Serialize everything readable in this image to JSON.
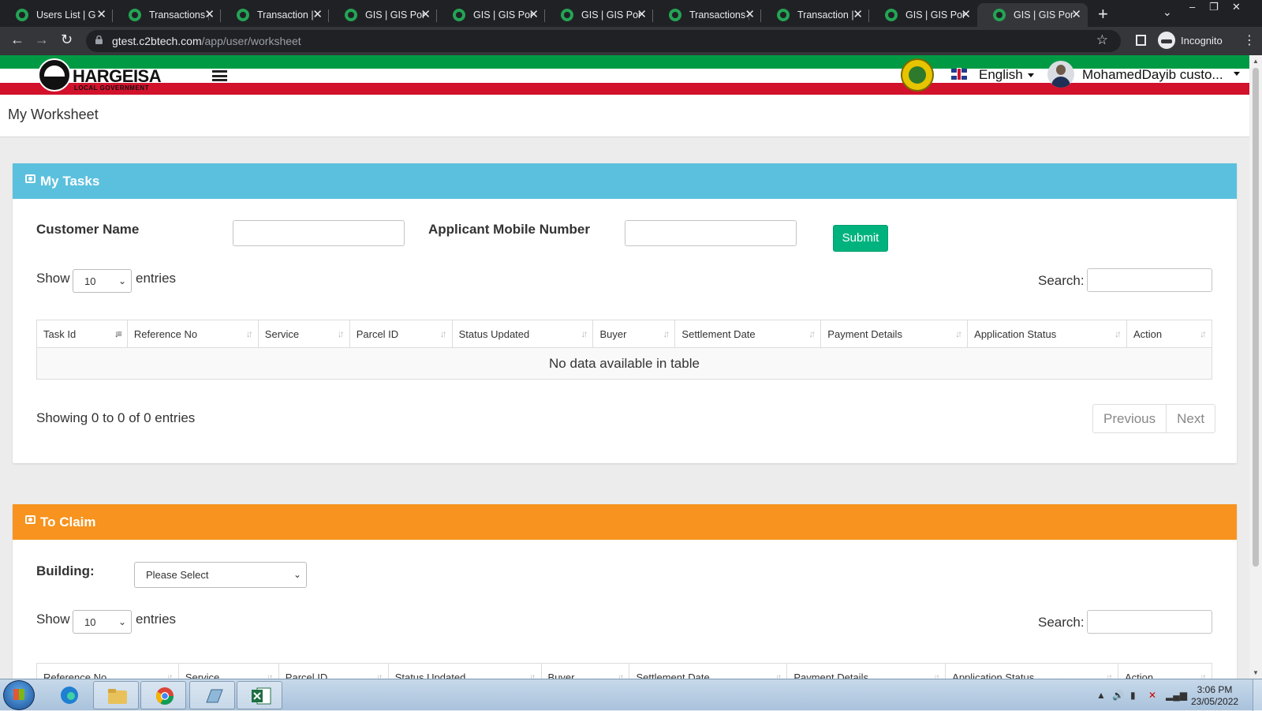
{
  "browser": {
    "tabs": [
      {
        "title": "Users List | GI",
        "active": false
      },
      {
        "title": "Transactions |",
        "active": false
      },
      {
        "title": "Transaction | C",
        "active": false
      },
      {
        "title": "GIS | GIS Port",
        "active": false
      },
      {
        "title": "GIS | GIS Port",
        "active": false
      },
      {
        "title": "GIS | GIS Port",
        "active": false
      },
      {
        "title": "Transactions |",
        "active": false
      },
      {
        "title": "Transaction | C",
        "active": false
      },
      {
        "title": "GIS | GIS Port",
        "active": false
      },
      {
        "title": "GIS | GIS Port",
        "active": true
      }
    ],
    "url_host": "gtest.c2btech.com",
    "url_path": "/app/user/worksheet",
    "incognito_label": "Incognito"
  },
  "header": {
    "logo_text": "HARGEISA",
    "logo_subtext": "LOCAL GOVERNMENT",
    "language": "English",
    "username": "MohamedDayib custo..."
  },
  "page": {
    "title": "My Worksheet"
  },
  "my_tasks": {
    "title": "My Tasks",
    "header_color": "#5bc0de",
    "customer_name_label": "Customer Name",
    "mobile_label": "Applicant Mobile Number",
    "submit_label": "Submit",
    "show_label": "Show",
    "entries_label": "entries",
    "page_length": "10",
    "search_label": "Search:",
    "columns": [
      "Task Id",
      "Reference No",
      "Service",
      "Parcel ID",
      "Status Updated",
      "Buyer",
      "Settlement Date",
      "Payment Details",
      "Application Status",
      "Action"
    ],
    "empty_text": "No data available in table",
    "info_text": "Showing 0 to 0 of 0 entries",
    "prev_label": "Previous",
    "next_label": "Next"
  },
  "to_claim": {
    "title": "To Claim",
    "header_color": "#f7931e",
    "building_label": "Building:",
    "building_value": "Please Select",
    "show_label": "Show",
    "entries_label": "entries",
    "page_length": "10",
    "search_label": "Search:",
    "columns": [
      "Reference No",
      "Service",
      "Parcel ID",
      "Status Updated",
      "Buyer",
      "Settlement Date",
      "Payment Details",
      "Application Status",
      "Action"
    ]
  },
  "taskbar": {
    "time": "3:06 PM",
    "date": "23/05/2022"
  },
  "colors": {
    "submit": "#00b37e",
    "band_green": "#009a44",
    "band_red": "#d2112b"
  }
}
